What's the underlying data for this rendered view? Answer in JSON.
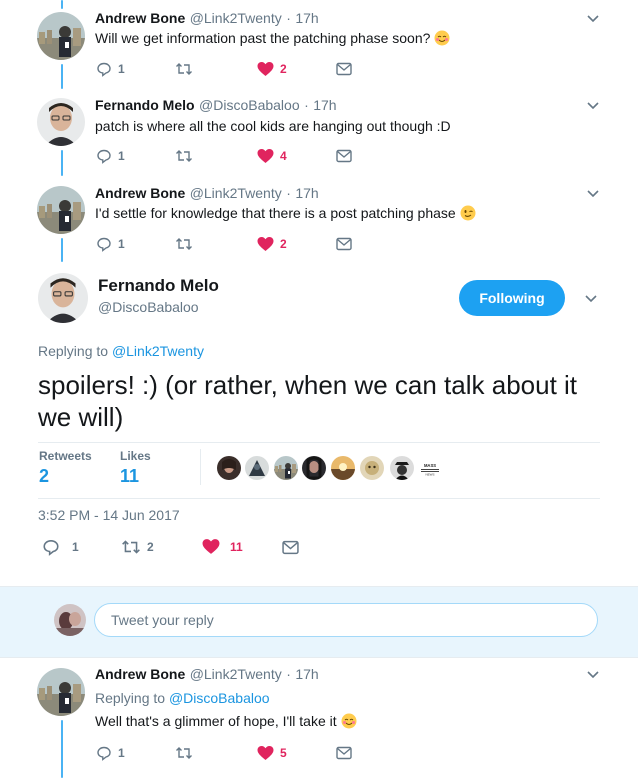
{
  "thread": [
    {
      "name": "Andrew Bone",
      "handle": "@Link2Twenty",
      "dot": "·",
      "time": "17h",
      "text": "Will we get information past the patching phase soon?",
      "emoji": "relieved-smile-emoji",
      "replies": "1",
      "likes": "2"
    },
    {
      "name": "Fernando Melo",
      "handle": "@DiscoBabaloo",
      "dot": "·",
      "time": "17h",
      "text": "patch is where all the cool kids are hanging out though :D",
      "replies": "1",
      "likes": "4"
    },
    {
      "name": "Andrew Bone",
      "handle": "@Link2Twenty",
      "dot": "·",
      "time": "17h",
      "text": "I'd settle for knowledge that there is a post patching phase",
      "emoji": "wink-emoji",
      "replies": "1",
      "likes": "2"
    }
  ],
  "main": {
    "name": "Fernando Melo",
    "handle": "@DiscoBabaloo",
    "follow_label": "Following",
    "replying_prefix": "Replying to",
    "replying_to": "@Link2Twenty",
    "text": "spoilers! :)  (or rather, when we can talk about it we will)",
    "retweets_label": "Retweets",
    "retweets": "2",
    "likes_label": "Likes",
    "likes": "11",
    "liker_logo_text": "MASS EFFECT NEWS",
    "timestamp": "3:52 PM - 14 Jun 2017",
    "actions": {
      "replies": "1",
      "retweets": "2",
      "likes": "11"
    }
  },
  "reply_box": {
    "placeholder": "Tweet your reply"
  },
  "last_reply": {
    "name": "Andrew Bone",
    "handle": "@Link2Twenty",
    "dot": "·",
    "time": "17h",
    "replying_prefix": "Replying to",
    "replying_to": "@DiscoBabaloo",
    "text": "Well that's a glimmer of hope, I'll take it",
    "emoji": "relieved-smile-emoji",
    "replies": "1",
    "likes": "5"
  },
  "colors": {
    "accent": "#1da1f2",
    "link": "#1b95e0",
    "like": "#e0245e",
    "thread_line": "#4ab3f4",
    "muted": "#657786"
  }
}
